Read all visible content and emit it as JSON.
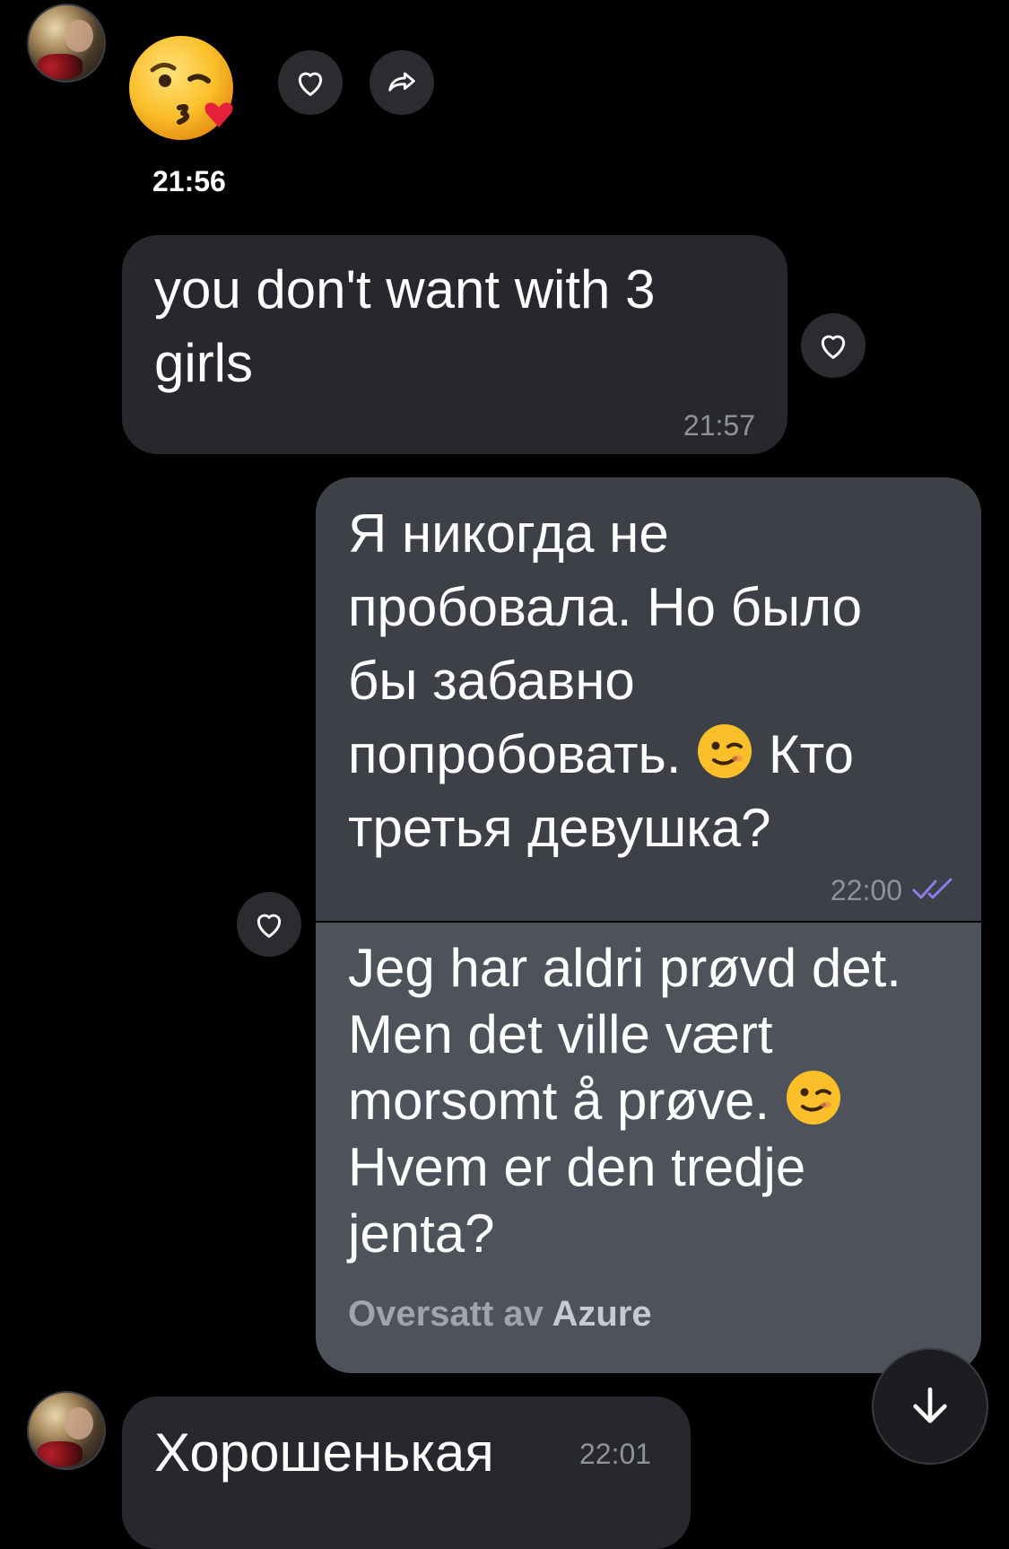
{
  "messages": {
    "first": {
      "emoji": "kissing-face-with-heart",
      "time": "21:56"
    },
    "second": {
      "text": "you don't want with 3\ngirls",
      "time": "21:57"
    },
    "outgoing": {
      "text_before_emoji": "Я никогда не\nпробовала. Но было\nбы забавно\nпопробовать. ",
      "text_after_emoji": " Кто\nтретья девушка?",
      "time": "22:00",
      "status": "read",
      "translation": {
        "text_before_emoji": "Jeg har aldri prøvd det.\nMen det ville vært\nmorsomt å prøve. ",
        "text_after_emoji": "\nHvem er den tredje\njenta?",
        "credit_prefix": "Oversatt av ",
        "credit_brand": "Azure"
      }
    },
    "last": {
      "text": "Хорошенькая",
      "time": "22:01"
    }
  },
  "colors": {
    "background": "#000000",
    "incoming_bubble": "#26282d",
    "outgoing_bubble": "#3d4047",
    "translation_bubble": "#4e535b",
    "read_ticks": "#8c7cf0"
  },
  "icons": [
    "avatar",
    "heart-icon",
    "share-icon",
    "double-check-icon",
    "arrow-down-icon",
    "winking-face-emoji"
  ]
}
